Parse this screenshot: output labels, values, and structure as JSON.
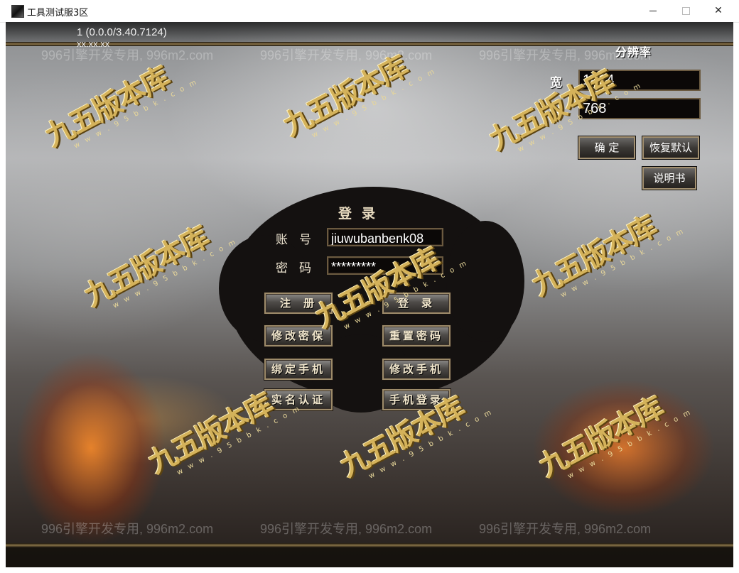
{
  "window": {
    "title": "工具测试服3区",
    "close_glyph": "✕"
  },
  "header": {
    "version": "1 (0.0.0/3.40.7124)",
    "ip": "xx.xx.xx"
  },
  "watermark_text": "996引擎开发专用, 996m2.com",
  "logo": {
    "main": "九五版本库",
    "sub": "w w w . 9 5 b b k . c o m"
  },
  "login": {
    "title": "登录",
    "account_label": "账号",
    "account_value": "jiuwubanbenk08",
    "password_label": "密码",
    "password_value": "*********",
    "buttons": {
      "register": "注册",
      "login": "登录",
      "modify_security": "修改密保",
      "reset_password": "重置密码",
      "bind_phone": "绑定手机",
      "modify_phone": "修改手机",
      "real_name": "实名认证",
      "phone_login": "手机登录"
    }
  },
  "resolution": {
    "title": "分辨率",
    "width_label": "宽",
    "width_value": "1024",
    "height_label": "高",
    "height_value": "768",
    "confirm": "确 定",
    "restore_default": "恢复默认",
    "manual": "说明书"
  }
}
